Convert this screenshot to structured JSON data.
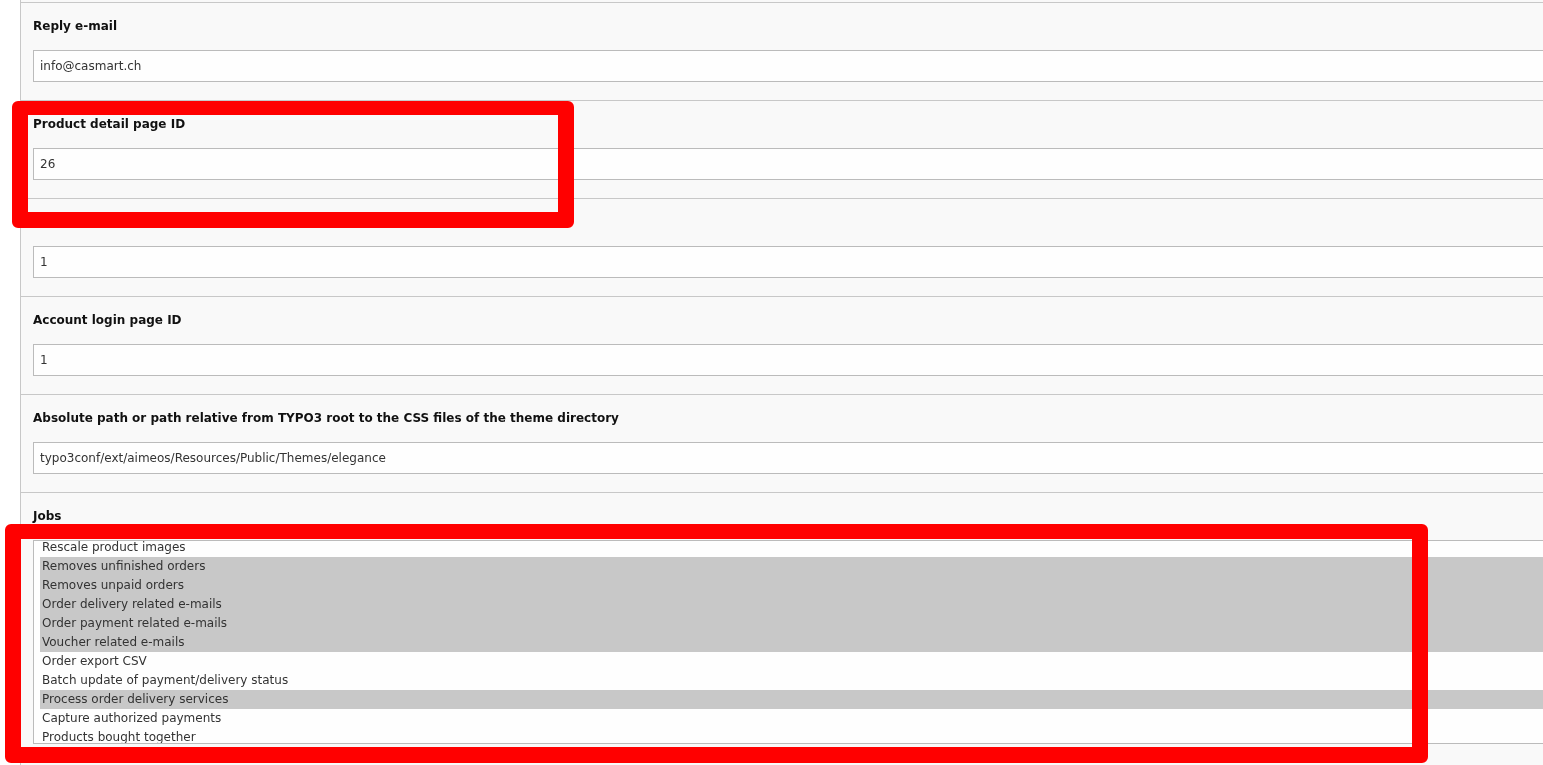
{
  "sections": [
    {
      "label": "Reply e-mail",
      "kind": "text",
      "value": "info@casmart.ch"
    },
    {
      "label": "Product detail page ID",
      "kind": "text",
      "value": "26"
    },
    {
      "kind": "text",
      "value": "1"
    },
    {
      "label": "Account login page ID",
      "kind": "text",
      "value": "1"
    },
    {
      "label": "Absolute path or path relative from TYPO3 root to the CSS files of the theme directory",
      "kind": "text",
      "value": "typo3conf/ext/aimeos/Resources/Public/Themes/elegance"
    },
    {
      "label": "Jobs",
      "kind": "multiselect",
      "options": [
        {
          "label": "Rescale product images",
          "selected": false
        },
        {
          "label": "Removes unfinished orders",
          "selected": true
        },
        {
          "label": "Removes unpaid orders",
          "selected": true
        },
        {
          "label": "Order delivery related e-mails",
          "selected": true
        },
        {
          "label": "Order payment related e-mails",
          "selected": true
        },
        {
          "label": "Voucher related e-mails",
          "selected": true
        },
        {
          "label": "Order export CSV",
          "selected": false
        },
        {
          "label": "Batch update of payment/delivery status",
          "selected": false
        },
        {
          "label": "Process order delivery services",
          "selected": true
        },
        {
          "label": "Capture authorized payments",
          "selected": false
        },
        {
          "label": "Products bought together",
          "selected": false
        }
      ]
    }
  ],
  "annotations": [
    {
      "kind": "box"
    },
    {
      "kind": "box"
    }
  ]
}
